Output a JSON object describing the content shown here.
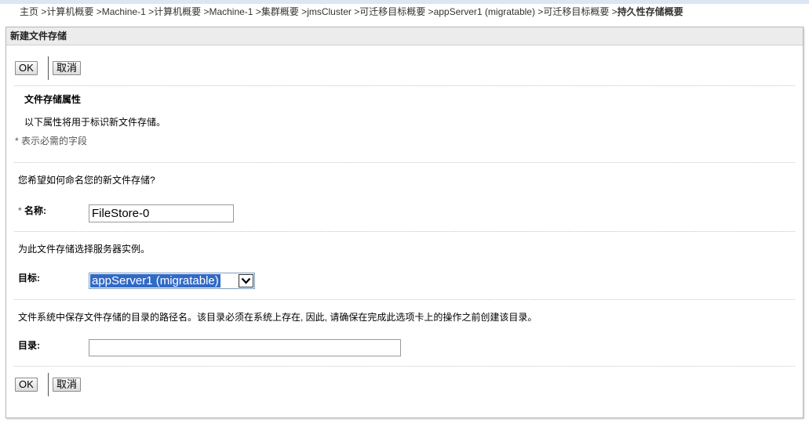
{
  "breadcrumb": {
    "items": [
      "主页",
      "计算机概要",
      "Machine-1",
      "计算机概要",
      "Machine-1",
      "集群概要",
      "jmsCluster",
      "可迁移目标概要",
      "appServer1 (migratable)",
      "可迁移目标概要"
    ],
    "separator": " >",
    "current": "持久性存储概要"
  },
  "panel": {
    "title": "新建文件存储"
  },
  "buttons": {
    "ok": "OK",
    "cancel": "取消"
  },
  "section": {
    "heading": "文件存储属性",
    "description": "以下属性将用于标识新文件存储。",
    "required_note": "* 表示必需的字段"
  },
  "name_field": {
    "question": "您希望如何命名您的新文件存储?",
    "required_mark": "*",
    "label": "名称:",
    "value": "FileStore-0"
  },
  "target_field": {
    "question": "为此文件存储选择服务器实例。",
    "label": "目标:",
    "selected": "appServer1 (migratable)"
  },
  "directory_field": {
    "question": "文件系统中保存文件存储的目录的路径名。该目录必须在系统上存在, 因此, 请确保在完成此选项卡上的操作之前创建该目录。",
    "label": "目录:",
    "value": ""
  }
}
